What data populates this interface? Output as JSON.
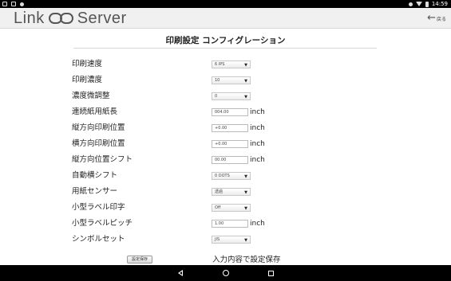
{
  "status_bar": {
    "time": "14:59",
    "left_icons": [
      "screenshot-icon",
      "voicemail-icon",
      "location-icon"
    ],
    "right_icons": [
      "bluetooth-icon",
      "wifi-icon",
      "battery-icon"
    ]
  },
  "header": {
    "logo_left": "Link",
    "logo_right": "Server",
    "back_label": "戻る"
  },
  "page": {
    "title": "印刷設定 コンフィグレーション"
  },
  "settings": [
    {
      "label": "印刷速度",
      "type": "select",
      "value": "6 IPS"
    },
    {
      "label": "印刷濃度",
      "type": "select",
      "value": "10"
    },
    {
      "label": "濃度微調整",
      "type": "select",
      "value": "0"
    },
    {
      "label": "連続紙用紙長",
      "type": "input",
      "value": "004.00",
      "unit": "inch"
    },
    {
      "label": "縦方向印刷位置",
      "type": "input",
      "value": "+0.00",
      "unit": "inch"
    },
    {
      "label": "横方向印刷位置",
      "type": "input",
      "value": "+0.00",
      "unit": "inch"
    },
    {
      "label": "縦方向位置シフト",
      "type": "input",
      "value": "00.00",
      "unit": "inch"
    },
    {
      "label": "自動横シフト",
      "type": "select",
      "value": "0 DOTS"
    },
    {
      "label": "用紙センサー",
      "type": "select",
      "value": "透過"
    },
    {
      "label": "小型ラベル印字",
      "type": "select",
      "value": "Off"
    },
    {
      "label": "小型ラベルピッチ",
      "type": "input",
      "value": "1.00",
      "unit": "inch"
    },
    {
      "label": "シンボルセット",
      "type": "select",
      "value": "JIS"
    }
  ],
  "save": {
    "button_label": "設定保存",
    "description": "入力内容で設定保存"
  }
}
